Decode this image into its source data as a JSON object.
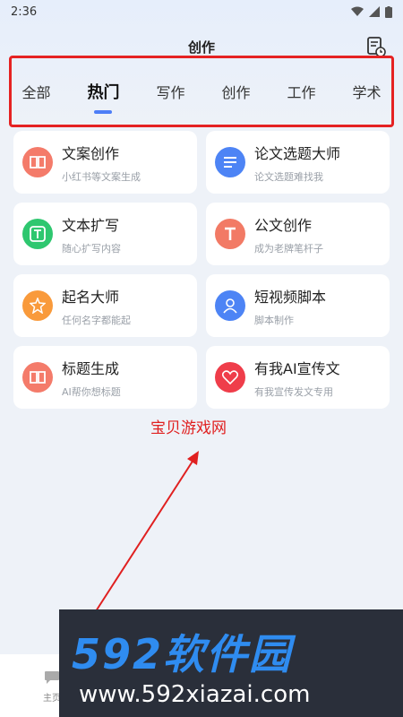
{
  "status_bar": {
    "time": "2:36"
  },
  "header": {
    "title": "创作"
  },
  "tabs": [
    {
      "label": "全部"
    },
    {
      "label": "热门",
      "active": true
    },
    {
      "label": "写作"
    },
    {
      "label": "创作"
    },
    {
      "label": "工作"
    },
    {
      "label": "学术"
    }
  ],
  "cards": [
    {
      "title": "文案创作",
      "subtitle": "小红书等文案生成",
      "icon": "book-icon",
      "color": "#f47b6a"
    },
    {
      "title": "论文选题大师",
      "subtitle": "论文选题难找我",
      "icon": "document-lines-icon",
      "color": "#4d84f5"
    },
    {
      "title": "文本扩写",
      "subtitle": "随心扩写内容",
      "icon": "text-t-icon",
      "color": "#2ec76f"
    },
    {
      "title": "公文创作",
      "subtitle": "成为老牌笔杆子",
      "icon": "letter-t-icon",
      "color": "#f27a65"
    },
    {
      "title": "起名大师",
      "subtitle": "任何名字都能起",
      "icon": "star-badge-icon",
      "color": "#f99a3b"
    },
    {
      "title": "短视频脚本",
      "subtitle": "脚本制作",
      "icon": "person-icon",
      "color": "#4d84f5"
    },
    {
      "title": "标题生成",
      "subtitle": "AI帮你想标题",
      "icon": "book-icon",
      "color": "#f47b6a"
    },
    {
      "title": "有我AI宣传文",
      "subtitle": "有我宣传发文专用",
      "icon": "heart-icon",
      "color": "#ef3d4a"
    }
  ],
  "annotation": {
    "text": "宝贝游戏网",
    "color": "#e02020"
  },
  "bottom_nav": {
    "item_label": "主页"
  },
  "watermark": {
    "logo": "592软件园",
    "url": "www.592xiazai.com"
  }
}
